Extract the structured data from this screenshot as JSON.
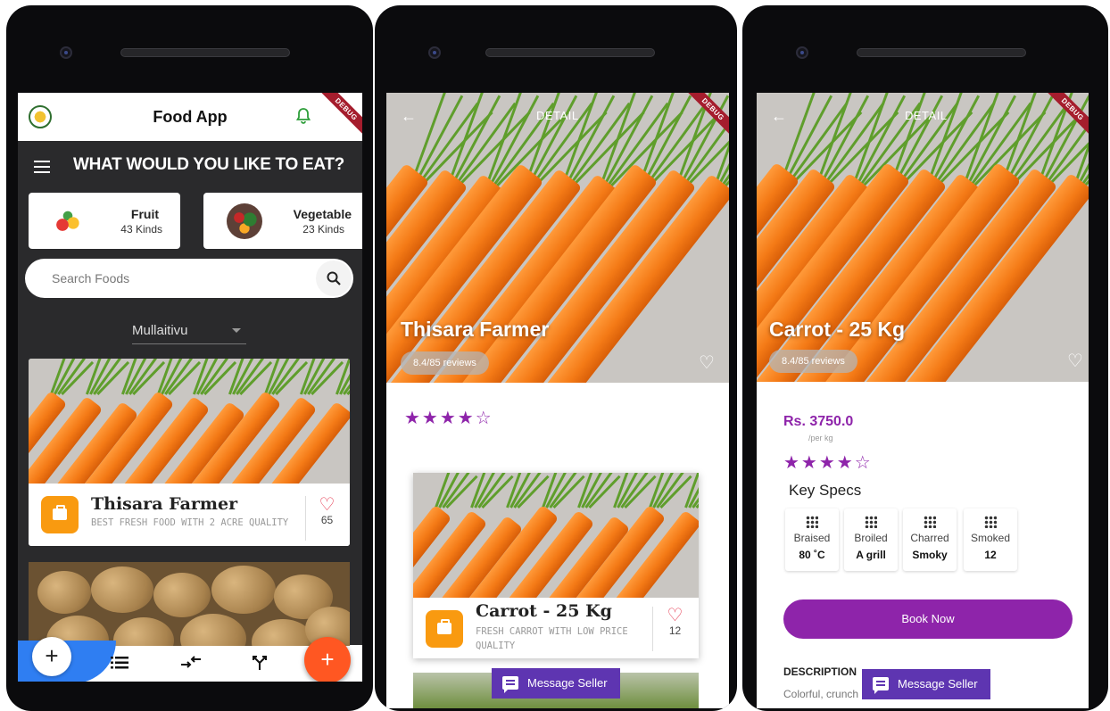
{
  "home": {
    "app_title": "Food App",
    "debug_banner": "DEBUG",
    "heading": "WHAT WOULD YOU LIKE TO EAT?",
    "categories": [
      {
        "name": "Fruit",
        "count": "43 Kinds"
      },
      {
        "name": "Vegetable",
        "count": "23 Kinds"
      }
    ],
    "search_placeholder": "Search Foods",
    "location": "Mullaitivu",
    "farm": {
      "name": "Thisara Farmer",
      "subtitle": "BEST FRESH FOOD WITH 2 ACRE QUALITY",
      "likes": "65"
    },
    "fab": "+",
    "nav_plus": "+"
  },
  "farmer_detail": {
    "debug_banner": "DEBUG",
    "back": "←",
    "label": "DETAIL",
    "title": "Thisara Farmer",
    "reviews": "8.4/85 reviews",
    "stars": "★★★★☆",
    "product": {
      "name": "Carrot - 25 Kg",
      "subtitle": "FRESH CARROT WITH LOW PRICE QUALITY",
      "likes": "12"
    },
    "message_seller": "Message Seller"
  },
  "product_detail": {
    "debug_banner": "DEBUG",
    "back": "←",
    "label": "DETAIL",
    "title": "Carrot - 25 Kg",
    "reviews": "8.4/85 reviews",
    "price": "Rs. 3750.0",
    "per_kg": "/per kg",
    "stars": "★★★★☆",
    "key_specs": "Key Specs",
    "specs": [
      {
        "name": "Braised",
        "value": "80 ˚C"
      },
      {
        "name": "Broiled",
        "value": "A grill"
      },
      {
        "name": "Charred",
        "value": "Smoky"
      },
      {
        "name": "Smoked",
        "value": "12"
      }
    ],
    "book_now": "Book Now",
    "description_label": "DESCRIPTION",
    "description_text": "Colorful, crunch",
    "message_seller": "Message Seller"
  },
  "colors": {
    "accent_purple": "#8e24aa",
    "fab_orange": "#ff5722",
    "bag_orange": "#f99a10",
    "nav_blue": "#2f7ef2",
    "message_btn": "#5e35b1"
  }
}
